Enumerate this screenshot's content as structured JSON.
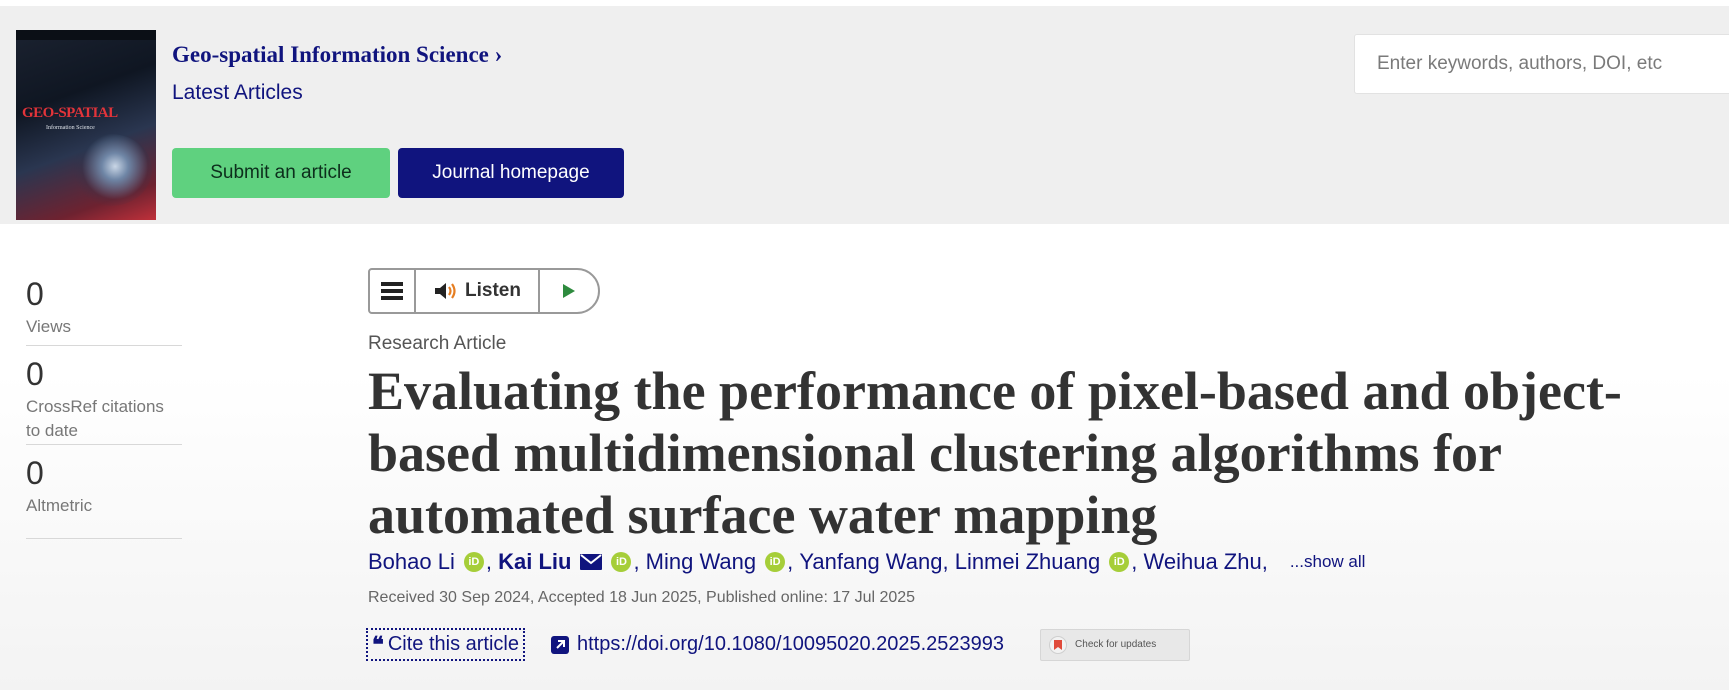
{
  "journal": {
    "cover": {
      "title": "GEO-SPATIAL",
      "subtitle": "Information Science"
    },
    "title": "Geo-spatial Information Science ›",
    "latest_articles": "Latest Articles",
    "submit_label": "Submit an article",
    "homepage_label": "Journal homepage"
  },
  "search": {
    "placeholder": "Enter keywords, authors, DOI, etc"
  },
  "metrics": [
    {
      "value": "0",
      "label": "Views"
    },
    {
      "value": "0",
      "label": "CrossRef citations to date"
    },
    {
      "value": "0",
      "label": "Altmetric"
    }
  ],
  "listen": {
    "label": "Listen"
  },
  "article": {
    "type": "Research Article",
    "title": "Evaluating the performance of pixel-based and object-based multidimensional clustering algorithms for automated surface water mapping",
    "authors": [
      {
        "name": "Bohao Li",
        "orcid": true
      },
      {
        "name": "Kai Liu",
        "corresponding": true,
        "orcid": true
      },
      {
        "name": "Ming Wang",
        "orcid": true
      },
      {
        "name": "Yanfang Wang",
        "orcid": false
      },
      {
        "name": "Linmei Zhuang",
        "orcid": true
      },
      {
        "name": "Weihua Zhu",
        "orcid": false
      }
    ],
    "show_all": "...show all",
    "dates": "Received 30 Sep 2024, Accepted 18 Jun 2025, Published online: 17 Jul 2025",
    "cite_label": "Cite this article",
    "doi": "https://doi.org/10.1080/10095020.2025.2523993",
    "check_updates": "Check for updates"
  },
  "colors": {
    "navy": "#10147e",
    "green": "#5fd17f",
    "orcid": "#a6ce39"
  }
}
